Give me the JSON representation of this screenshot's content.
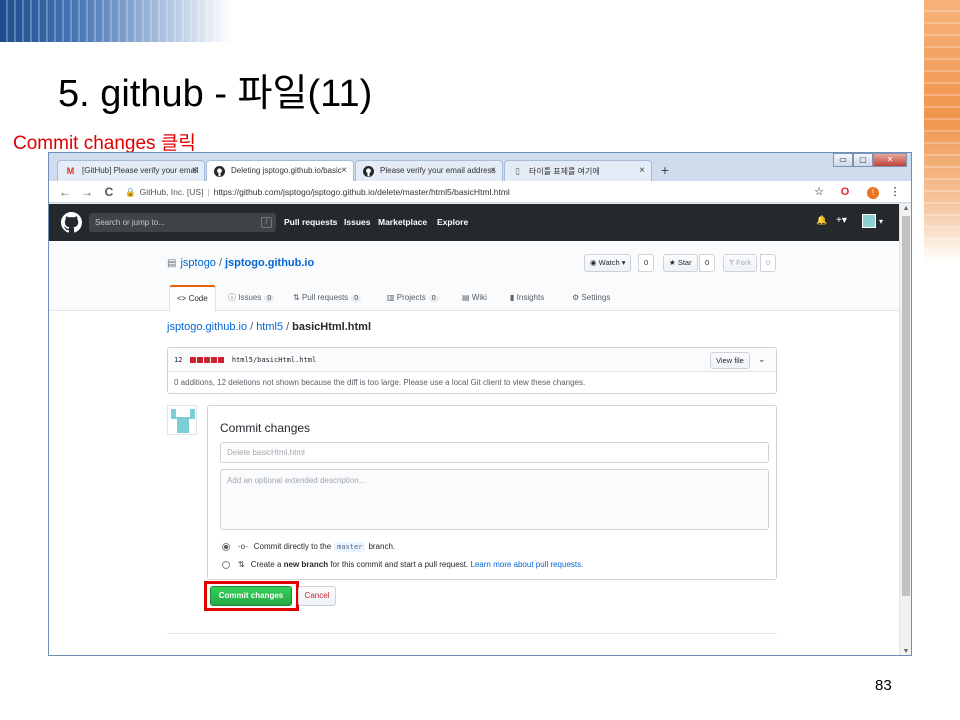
{
  "slide": {
    "title": "5. github - 파일(11)",
    "note": "Commit changes 클릭",
    "page_number": "83"
  },
  "browser": {
    "tabs": [
      {
        "icon": "gmail-icon",
        "label": "[GitHub] Please verify your email",
        "close": "×"
      },
      {
        "icon": "github-icon",
        "label": "Deleting jsptogo.github.io/basic",
        "close": "×"
      },
      {
        "icon": "github-icon",
        "label": "Please verify your email address",
        "close": "×"
      },
      {
        "icon": "page-icon",
        "label": "타이틀 표제를 여기에",
        "close": "×"
      }
    ],
    "new_tab": "+",
    "window_buttons": [
      "▭",
      "▢",
      "✕"
    ],
    "nav": {
      "back": "←",
      "forward": "→",
      "reload": "C"
    },
    "address": {
      "origin": "GitHub, Inc. [US]",
      "url": "https://github.com/jsptogo/jsptogo.github.io/delete/master/html5/basicHtml.html"
    },
    "toolbar_icons": {
      "star": "☆",
      "opera": "O",
      "profile": "!",
      "menu": "⋮"
    }
  },
  "github": {
    "header": {
      "search_placeholder": "Search or jump to...",
      "search_key": "/",
      "nav": [
        "Pull requests",
        "Issues",
        "Marketplace",
        "Explore"
      ],
      "bell": "🔔",
      "plus": "+▾",
      "avatar_caret": "▾"
    },
    "repo": {
      "owner": "jsptogo",
      "separator": "/",
      "name": "jsptogo.github.io",
      "watch": {
        "label": "Watch ▾",
        "count": "0"
      },
      "star": {
        "label": "Star",
        "count": "0"
      },
      "fork": {
        "label": "Fork",
        "count": "0"
      }
    },
    "tabs": [
      {
        "icon": "<>",
        "label": "Code",
        "count": ""
      },
      {
        "icon": "ⓘ",
        "label": "Issues",
        "count": "0"
      },
      {
        "icon": "⇅",
        "label": "Pull requests",
        "count": "0"
      },
      {
        "icon": "▥",
        "label": "Projects",
        "count": "0"
      },
      {
        "icon": "▤",
        "label": "Wiki",
        "count": ""
      },
      {
        "icon": "▮",
        "label": "Insights",
        "count": ""
      },
      {
        "icon": "⚙",
        "label": "Settings",
        "count": ""
      }
    ],
    "breadcrumb": {
      "root": "jsptogo.github.io",
      "folder": "html5",
      "file": "basicHtml.html",
      "sep": "/"
    },
    "diff": {
      "count": "12",
      "path": "html5/basicHtml.html",
      "view_file": "View file",
      "chevron": "⌄",
      "note": "0 additions, 12 deletions not shown because the diff is too large. Please use a local Git client to view these changes."
    },
    "commit": {
      "title": "Commit changes",
      "summary_placeholder": "Delete basicHtml.html",
      "description_placeholder": "Add an optional extended description…",
      "option_direct_prefix": "Commit directly to the",
      "option_direct_branch": "master",
      "option_direct_suffix": "branch.",
      "option_new_prefix": "Create a",
      "option_new_bold": "new branch",
      "option_new_mid": "for this commit and start a pull request.",
      "option_new_link": "Learn more about pull requests.",
      "commit_button": "Commit changes",
      "cancel_button": "Cancel"
    }
  },
  "colors": {
    "highlight": "#e00000",
    "github_header": "#24292e",
    "primary_button": "#28a745",
    "link": "#0366d6"
  }
}
